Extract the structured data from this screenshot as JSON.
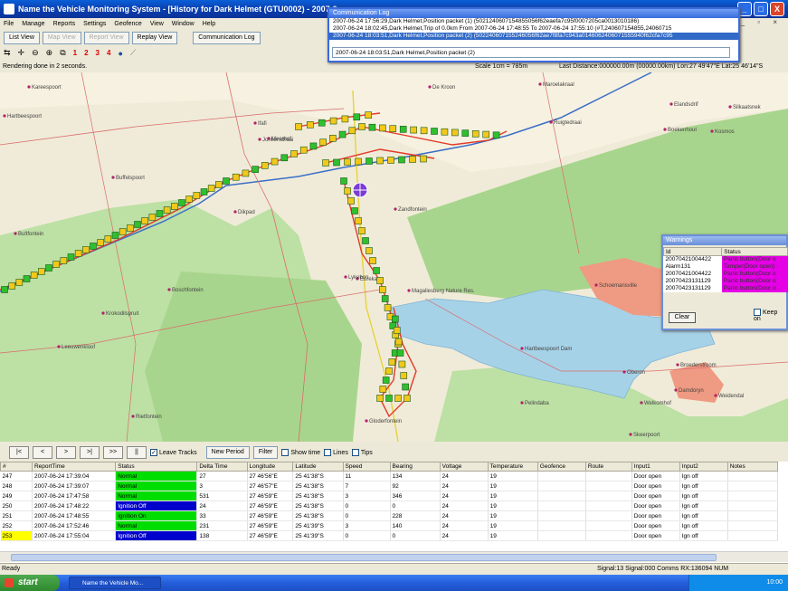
{
  "window": {
    "title": "Name the Vehicle Monitoring System - [History for Dark Helmet (GTU0002) - 2007-0",
    "btn_min": "_",
    "btn_max": "□",
    "btn_close": "X"
  },
  "menu": [
    "File",
    "Manage",
    "Reports",
    "Settings",
    "Geofence",
    "View",
    "Window",
    "Help"
  ],
  "mdi_controls": "_ ▫ ×",
  "toolbar": {
    "buttons": [
      {
        "label": "List View",
        "enabled": true
      },
      {
        "label": "Map View",
        "enabled": false
      },
      {
        "label": "Report View",
        "enabled": false
      },
      {
        "label": "Replay View",
        "enabled": true
      },
      {
        "label": "Communication Log",
        "enabled": true
      }
    ],
    "tools": [
      "1",
      "2",
      "3",
      "4"
    ]
  },
  "statusline": {
    "message": "Rendering done in 2 seconds.",
    "scale": "Scale 1cm = 785m",
    "last_distance": "Last Distance:000000.00m (00000.00km) Lon:27 49'47\"E Lat:25 46'14\"S"
  },
  "comm_log": {
    "title": "Communication Log",
    "lines": [
      "2007-06-24 17:56:29,Dark Helmet,Position packet (1) (5021240607154855056f62eaefa7c95f0007205ca0013010186)",
      "2007-06-24 18:02:45,Dark Helmet,Trip of 0.0km From 2007-06-24 17:48:55 To 2007-06-24 17:55:10 (#T,240607154855,24060715",
      "2007-06-24 18:03:51,Dark Helmet,Position packet (2) (502240607155246056f62ae7f8fa7c943a0146062406071555940f62cfa7c95"
    ],
    "input_value": "2007-06-24 18:03:51,Dark Helmet,Position packet (2)"
  },
  "warnings": {
    "title": "Warnings",
    "headers": [
      "Id",
      "Status"
    ],
    "rows": [
      {
        "id": "20070421004422",
        "status": "Panic button(Door o"
      },
      {
        "id": "Alarm131",
        "status": "Tamper(Door open)"
      },
      {
        "id": "20070421004422",
        "status": "Panic button(Door o"
      },
      {
        "id": "20070423131129",
        "status": "Panic button(Door o"
      },
      {
        "id": "20070423131129",
        "status": "Panic button(Door o"
      }
    ],
    "clear_label": "Clear",
    "keep_label": "Keep on"
  },
  "map": {
    "places": [
      {
        "name": "Kareespoort"
      },
      {
        "name": "Hartbeespoort"
      },
      {
        "name": "Buffelspoort"
      },
      {
        "name": "Ifafi"
      },
      {
        "name": "Meerhof"
      },
      {
        "name": "De Kroon"
      },
      {
        "name": "Maroelakraal"
      },
      {
        "name": "Ruigtedraai"
      },
      {
        "name": "Elandsdrif"
      },
      {
        "name": "Kosmos"
      },
      {
        "name": "Boekenhout"
      },
      {
        "name": "Jonkersdraai"
      },
      {
        "name": "Silkaatsnek"
      },
      {
        "name": "Ifafi Estate"
      },
      {
        "name": "Schoemansville"
      },
      {
        "name": "Broederstroom"
      },
      {
        "name": "Hartbeespoort Dam"
      },
      {
        "name": "Damdoryn"
      },
      {
        "name": "Pelindaba"
      },
      {
        "name": "Skeerpoort"
      },
      {
        "name": "Rietfontein"
      },
      {
        "name": "Bultfontein"
      },
      {
        "name": "Zandfontein"
      },
      {
        "name": "Eureka"
      },
      {
        "name": "Magaliesberg Nature Res."
      },
      {
        "name": "Leeuwenkloof"
      },
      {
        "name": "Krokodilspruit"
      },
      {
        "name": "Boschfontein"
      },
      {
        "name": "Gloderfontein"
      },
      {
        "name": "Oberon"
      },
      {
        "name": "Welkomhof"
      },
      {
        "name": "Weidendal"
      },
      {
        "name": "Lykebon"
      },
      {
        "name": "Dikpad"
      }
    ],
    "road_labels": [
      "R511",
      "R512",
      "R560",
      "N4"
    ]
  },
  "controls": {
    "nav": [
      "|<",
      "<",
      ">",
      ">|",
      ">>",
      "||"
    ],
    "leave_tracks": "Leave Tracks",
    "new_period": "New Period",
    "filter": "Filter",
    "show_time": "Show time",
    "lines": "Lines",
    "tips": "Tips"
  },
  "grid": {
    "headers": [
      "#",
      "ReportTime",
      "Status",
      "Delta Time",
      "Longitude",
      "Latitude",
      "Speed",
      "Bearing",
      "Voltage",
      "Temperature",
      "Geofence",
      "Route",
      "Input1",
      "Input2",
      "Notes"
    ],
    "rows": [
      {
        "num": "247",
        "time": "2007-06-24 17:39:04",
        "status": "Normal",
        "status_color": "#00dd00",
        "delta": "27",
        "lon": "27 46'56\"E",
        "lat": "25 41'38\"S",
        "speed": "11",
        "bearing": "134",
        "voltage": "24",
        "temp": "19",
        "geofence": "",
        "route": "",
        "input1": "Door open",
        "input2": "Ign off",
        "notes": ""
      },
      {
        "num": "248",
        "time": "2007-06-24 17:39:07",
        "status": "Normal",
        "status_color": "#00dd00",
        "delta": "3",
        "lon": "27 46'57\"E",
        "lat": "25 41'38\"S",
        "speed": "7",
        "bearing": "92",
        "voltage": "24",
        "temp": "19",
        "geofence": "",
        "route": "",
        "input1": "Door open",
        "input2": "Ign off",
        "notes": ""
      },
      {
        "num": "249",
        "time": "2007-06-24 17:47:58",
        "status": "Normal",
        "status_color": "#00dd00",
        "delta": "531",
        "lon": "27 46'59\"E",
        "lat": "25 41'38\"S",
        "speed": "3",
        "bearing": "346",
        "voltage": "24",
        "temp": "19",
        "geofence": "",
        "route": "",
        "input1": "Door open",
        "input2": "Ign off",
        "notes": ""
      },
      {
        "num": "250",
        "time": "2007-06-24 17:48:22",
        "status": "Ignition Off",
        "status_color": "#0000cc",
        "delta": "24",
        "lon": "27 46'59\"E",
        "lat": "25 41'38\"S",
        "speed": "0",
        "bearing": "0",
        "voltage": "24",
        "temp": "19",
        "geofence": "",
        "route": "",
        "input1": "Door open",
        "input2": "Ign off",
        "notes": ""
      },
      {
        "num": "251",
        "time": "2007-06-24 17:48:55",
        "status": "Ignition On",
        "status_color": "#00dd00",
        "delta": "33",
        "lon": "27 46'59\"E",
        "lat": "25 41'38\"S",
        "speed": "0",
        "bearing": "228",
        "voltage": "24",
        "temp": "19",
        "geofence": "",
        "route": "",
        "input1": "Door open",
        "input2": "Ign off",
        "notes": ""
      },
      {
        "num": "252",
        "time": "2007-06-24 17:52:46",
        "status": "Normal",
        "status_color": "#00dd00",
        "delta": "231",
        "lon": "27 46'59\"E",
        "lat": "25 41'39\"S",
        "speed": "3",
        "bearing": "140",
        "voltage": "24",
        "temp": "19",
        "geofence": "",
        "route": "",
        "input1": "Door open",
        "input2": "Ign off",
        "notes": ""
      },
      {
        "num": "253",
        "time": "2007-06-24 17:55:04",
        "status": "Ignition Off",
        "status_color": "#0000cc",
        "delta": "138",
        "lon": "27 46'59\"E",
        "lat": "25 41'39\"S",
        "speed": "0",
        "bearing": "0",
        "voltage": "24",
        "temp": "19",
        "geofence": "",
        "route": "",
        "input1": "Door open",
        "input2": "Ign off",
        "notes": ""
      }
    ]
  },
  "appstatus": {
    "left": "Ready",
    "right": "Signal:13   Signal:000   Comms RX:136094          NUM"
  },
  "taskbar": {
    "start": "start",
    "task": "Name the Vehicle Mo...",
    "clock": "10:00"
  }
}
